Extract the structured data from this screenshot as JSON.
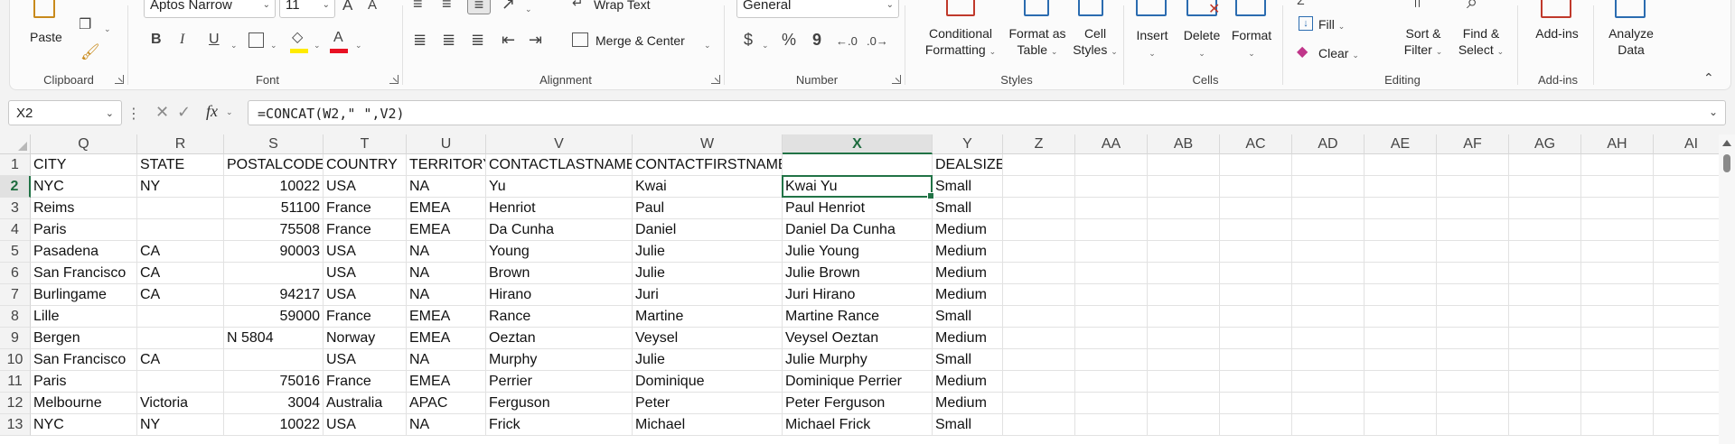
{
  "ribbon": {
    "clipboard": {
      "label": "Clipboard",
      "paste": "Paste"
    },
    "font": {
      "label": "Font",
      "name": "Aptos Narrow",
      "size": "11",
      "bold": "B",
      "italic": "I",
      "underline": "U",
      "grow": "A",
      "shrink": "A"
    },
    "alignment": {
      "label": "Alignment",
      "wrap_text": "Wrap Text",
      "merge_center": "Merge & Center"
    },
    "number": {
      "label": "Number",
      "format": "General",
      "currency": "$",
      "percent": "%",
      "comma": "9"
    },
    "styles": {
      "label": "Styles",
      "conditional_1": "Conditional",
      "conditional_2": "Formatting",
      "format_table_1": "Format as",
      "format_table_2": "Table",
      "cell_styles_1": "Cell",
      "cell_styles_2": "Styles"
    },
    "cells": {
      "label": "Cells",
      "insert": "Insert",
      "delete": "Delete",
      "format": "Format"
    },
    "editing": {
      "label": "Editing",
      "fill": "Fill",
      "clear": "Clear",
      "sort_1": "Sort &",
      "sort_2": "Filter",
      "find_1": "Find &",
      "find_2": "Select"
    },
    "addins": {
      "label": "Add-ins",
      "addins": "Add-ins",
      "analyze_1": "Analyze",
      "analyze_2": "Data"
    }
  },
  "formula_bar": {
    "name_box": "X2",
    "fx": "fx",
    "formula": "=CONCAT(W2,\" \",V2)"
  },
  "columns": [
    "Q",
    "R",
    "S",
    "T",
    "U",
    "V",
    "W",
    "X",
    "Y",
    "Z",
    "AA",
    "AB",
    "AC",
    "AD",
    "AE",
    "AF",
    "AG",
    "AH",
    "AI"
  ],
  "selected_column": "X",
  "selected_row": "2",
  "rows": [
    {
      "n": "1",
      "cells": [
        "CITY",
        "STATE",
        "POSTALCODE",
        "COUNTRY",
        "TERRITORY",
        "CONTACTLASTNAME",
        "CONTACTFIRSTNAME",
        "",
        "DEALSIZE"
      ]
    },
    {
      "n": "2",
      "cells": [
        "NYC",
        "NY",
        "10022",
        "USA",
        "NA",
        "Yu",
        "Kwai",
        "Kwai Yu",
        "Small"
      ]
    },
    {
      "n": "3",
      "cells": [
        "Reims",
        "",
        "51100",
        "France",
        "EMEA",
        "Henriot",
        "Paul",
        "Paul Henriot",
        "Small"
      ]
    },
    {
      "n": "4",
      "cells": [
        "Paris",
        "",
        "75508",
        "France",
        "EMEA",
        "Da Cunha",
        "Daniel",
        "Daniel Da Cunha",
        "Medium"
      ]
    },
    {
      "n": "5",
      "cells": [
        "Pasadena",
        "CA",
        "90003",
        "USA",
        "NA",
        "Young",
        "Julie",
        "Julie Young",
        "Medium"
      ]
    },
    {
      "n": "6",
      "cells": [
        "San Francisco",
        "CA",
        "",
        "USA",
        "NA",
        "Brown",
        "Julie",
        "Julie Brown",
        "Medium"
      ]
    },
    {
      "n": "7",
      "cells": [
        "Burlingame",
        "CA",
        "94217",
        "USA",
        "NA",
        "Hirano",
        "Juri",
        "Juri Hirano",
        "Medium"
      ]
    },
    {
      "n": "8",
      "cells": [
        "Lille",
        "",
        "59000",
        "France",
        "EMEA",
        "Rance",
        "Martine",
        "Martine Rance",
        "Small"
      ]
    },
    {
      "n": "9",
      "cells": [
        "Bergen",
        "",
        "N 5804",
        "Norway",
        "EMEA",
        "Oeztan",
        "Veysel",
        "Veysel Oeztan",
        "Medium"
      ]
    },
    {
      "n": "10",
      "cells": [
        "San Francisco",
        "CA",
        "",
        "USA",
        "NA",
        "Murphy",
        "Julie",
        "Julie Murphy",
        "Small"
      ]
    },
    {
      "n": "11",
      "cells": [
        "Paris",
        "",
        "75016",
        "France",
        "EMEA",
        "Perrier",
        "Dominique",
        "Dominique Perrier",
        "Medium"
      ]
    },
    {
      "n": "12",
      "cells": [
        "Melbourne",
        "Victoria",
        "3004",
        "Australia",
        "APAC",
        "Ferguson",
        "Peter",
        "Peter Ferguson",
        "Medium"
      ]
    },
    {
      "n": "13",
      "cells": [
        "NYC",
        "NY",
        "10022",
        "USA",
        "NA",
        "Frick",
        "Michael",
        "Michael Frick",
        "Small"
      ]
    }
  ],
  "colors": {
    "accent": "#217346",
    "font_color": "#e81123",
    "fill_color": "#ffeb00"
  }
}
